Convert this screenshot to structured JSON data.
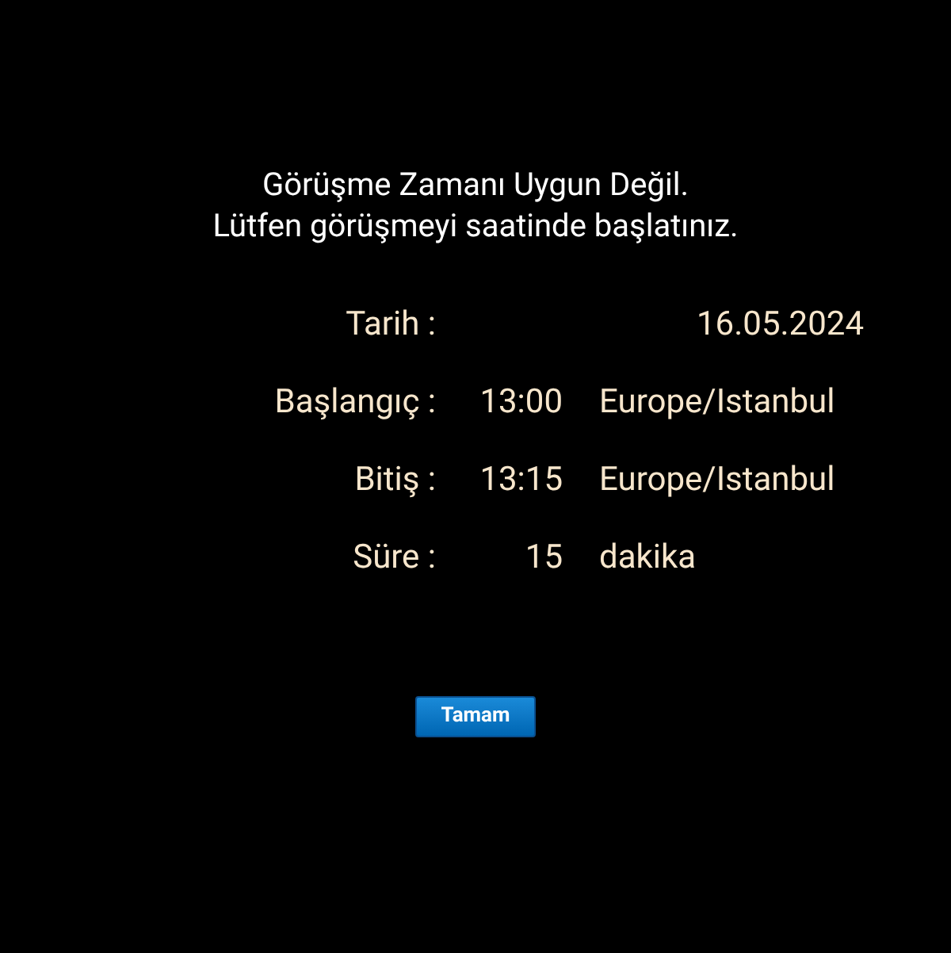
{
  "message": [
    "Görüşme Zamanı Uygun Değil.",
    "Lütfen görüşmeyi saatinde başlatınız."
  ],
  "details": [
    {
      "kind": "wide",
      "label": "Tarih :",
      "value": "16.05.2024"
    },
    {
      "kind": "split",
      "label": "Başlangıç :",
      "value": "13:00",
      "unit": "Europe/Istanbul"
    },
    {
      "kind": "split",
      "label": "Bitiş :",
      "value": "13:15",
      "unit": "Europe/Istanbul"
    },
    {
      "kind": "split",
      "label": "Süre :",
      "value": "15",
      "unit": "dakika"
    }
  ],
  "button": "Tamam"
}
